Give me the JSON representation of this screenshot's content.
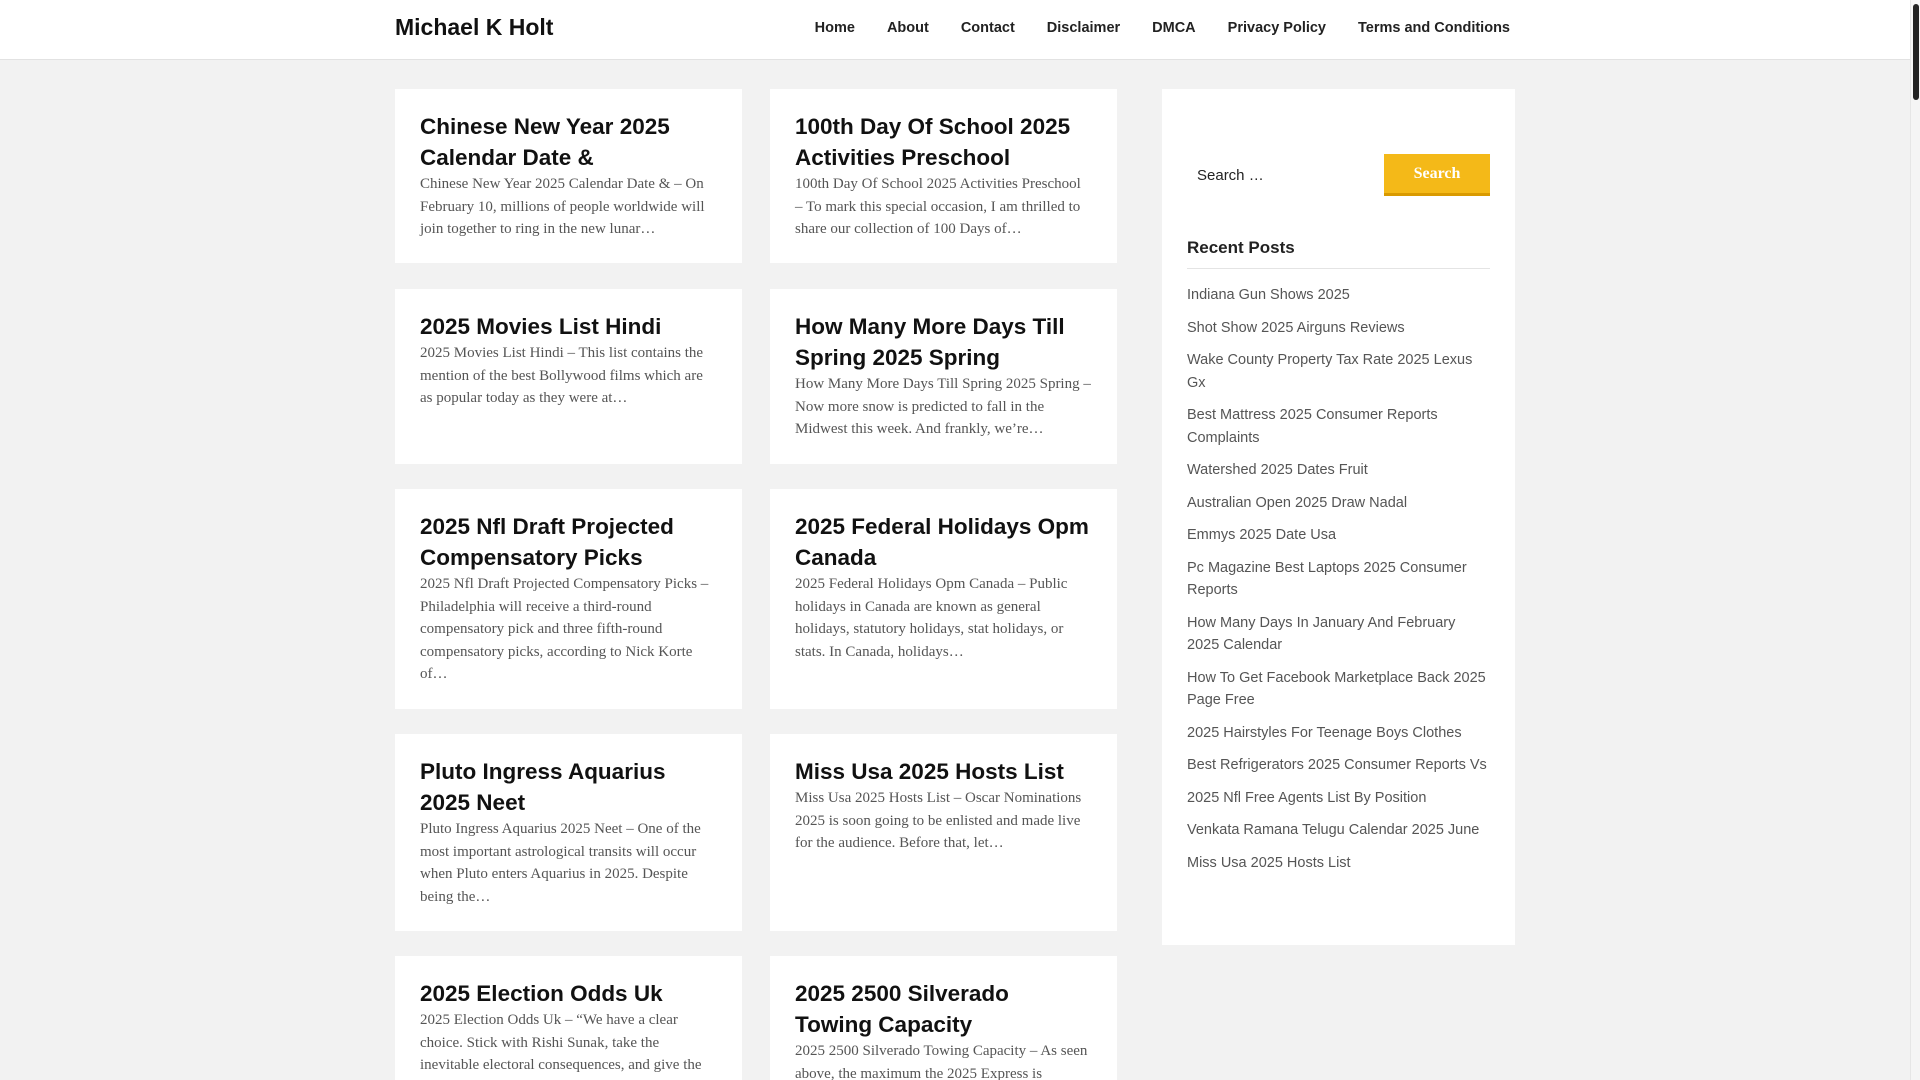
{
  "site": {
    "title": "Michael K Holt"
  },
  "nav": {
    "items": [
      {
        "label": "Home"
      },
      {
        "label": "About"
      },
      {
        "label": "Contact"
      },
      {
        "label": "Disclaimer"
      },
      {
        "label": "DMCA"
      },
      {
        "label": "Privacy Policy"
      },
      {
        "label": "Terms and Conditions"
      }
    ]
  },
  "posts": [
    {
      "title": "Chinese New Year 2025 Calendar Date &",
      "excerpt": "Chinese New Year 2025 Calendar Date & – On February 10, millions of people worldwide will join together to ring in the new lunar…"
    },
    {
      "title": "100th Day Of School 2025 Activities Preschool",
      "excerpt": "100th Day Of School 2025 Activities Preschool – To mark this special occasion, I am thrilled to share our collection of 100 Days of…"
    },
    {
      "title": "2025 Movies List Hindi",
      "excerpt": "2025 Movies List Hindi – This list contains the mention of the best Bollywood films which are as popular today as they were at…"
    },
    {
      "title": "How Many More Days Till Spring 2025 Spring",
      "excerpt": "How Many More Days Till Spring 2025 Spring – Now more snow is predicted to fall in the Midwest this week. And frankly, we’re…"
    },
    {
      "title": "2025 Nfl Draft Projected Compensatory Picks",
      "excerpt": "2025 Nfl Draft Projected Compensatory Picks – Philadelphia will receive a third-round compensatory pick and three fifth-round compensatory picks, according to Nick Korte of…"
    },
    {
      "title": "2025 Federal Holidays Opm Canada",
      "excerpt": "2025 Federal Holidays Opm Canada – Public holidays in Canada are known as general holidays, statutory holidays, stat holidays, or stats. In Canada, holidays…"
    },
    {
      "title": "Pluto Ingress Aquarius 2025 Neet",
      "excerpt": "Pluto Ingress Aquarius 2025 Neet – One of the most important astrological transits will occur when Pluto enters Aquarius in 2025. Despite being the…"
    },
    {
      "title": "Miss Usa 2025 Hosts List",
      "excerpt": "Miss Usa 2025 Hosts List – Oscar Nominations 2025 is soon going to be enlisted and made live for the audience. Before that, let…"
    },
    {
      "title": "2025 Election Odds Uk",
      "excerpt": "2025 Election Odds Uk – “We have a clear choice. Stick with Rishi Sunak, take the inevitable electoral consequences, and give the"
    },
    {
      "title": "2025 2500 Silverado Towing Capacity",
      "excerpt": "2025 2500 Silverado Towing Capacity – As seen above, the maximum the 2025 Express is"
    }
  ],
  "sidebar": {
    "search": {
      "placeholder": "Search …",
      "button_label": "Search"
    },
    "recent_title": "Recent Posts",
    "recent_posts": [
      "Indiana Gun Shows 2025",
      "Shot Show 2025 Airguns Reviews",
      "Wake County Property Tax Rate 2025 Lexus Gx",
      "Best Mattress 2025 Consumer Reports Complaints",
      "Watershed 2025 Dates Fruit",
      "Australian Open 2025 Draw Nadal",
      "Emmys 2025 Date Usa",
      "Pc Magazine Best Laptops 2025 Consumer Reports",
      "How Many Days In January And February 2025 Calendar",
      "How To Get Facebook Marketplace Back 2025 Page Free",
      "2025 Hairstyles For Teenage Boys Clothes",
      "Best Refrigerators 2025 Consumer Reports Vs",
      "2025 Nfl Free Agents List By Position",
      "Venkata Ramana Telugu Calendar 2025 June",
      "Miss Usa 2025 Hosts List"
    ]
  }
}
